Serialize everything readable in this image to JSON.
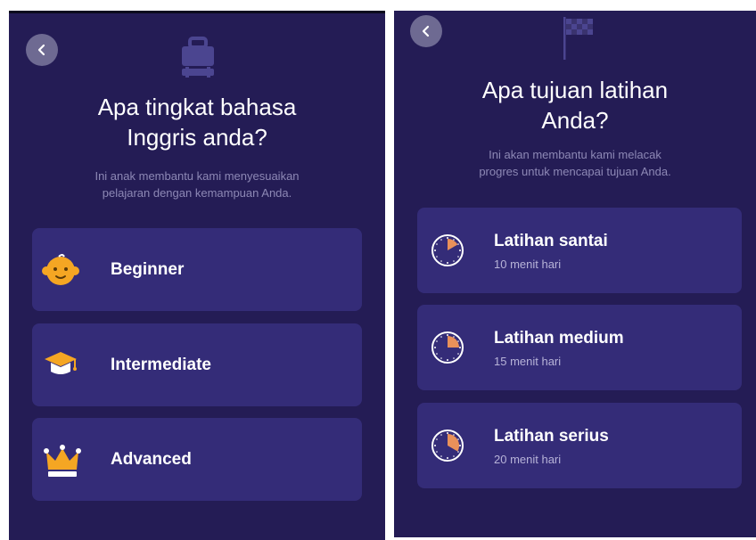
{
  "left_screen": {
    "title_line1": "Apa tingkat bahasa",
    "title_line2": "Inggris anda?",
    "subtitle_line1": "Ini anak membantu kami menyesuaikan",
    "subtitle_line2": "pelajaran dengan kemampuan Anda.",
    "options": [
      {
        "label": "Beginner",
        "icon": "baby-face-icon"
      },
      {
        "label": "Intermediate",
        "icon": "graduation-cap-icon"
      },
      {
        "label": "Advanced",
        "icon": "crown-icon"
      }
    ]
  },
  "right_screen": {
    "title_line1": "Apa tujuan latihan",
    "title_line2": "Anda?",
    "subtitle_line1": "Ini akan membantu kami melacak",
    "subtitle_line2": "progres untuk mencapai tujuan Anda.",
    "options": [
      {
        "label": "Latihan santai",
        "sub": "10 menit hari",
        "icon": "clock-10-icon"
      },
      {
        "label": "Latihan medium",
        "sub": "15 menit hari",
        "icon": "clock-15-icon"
      },
      {
        "label": "Latihan serius",
        "sub": "20 menit hari",
        "icon": "clock-20-icon"
      }
    ]
  },
  "colors": {
    "background": "#241c55",
    "card": "#342c78",
    "accent_orange": "#f5a623",
    "text_muted": "#8d88b5"
  }
}
